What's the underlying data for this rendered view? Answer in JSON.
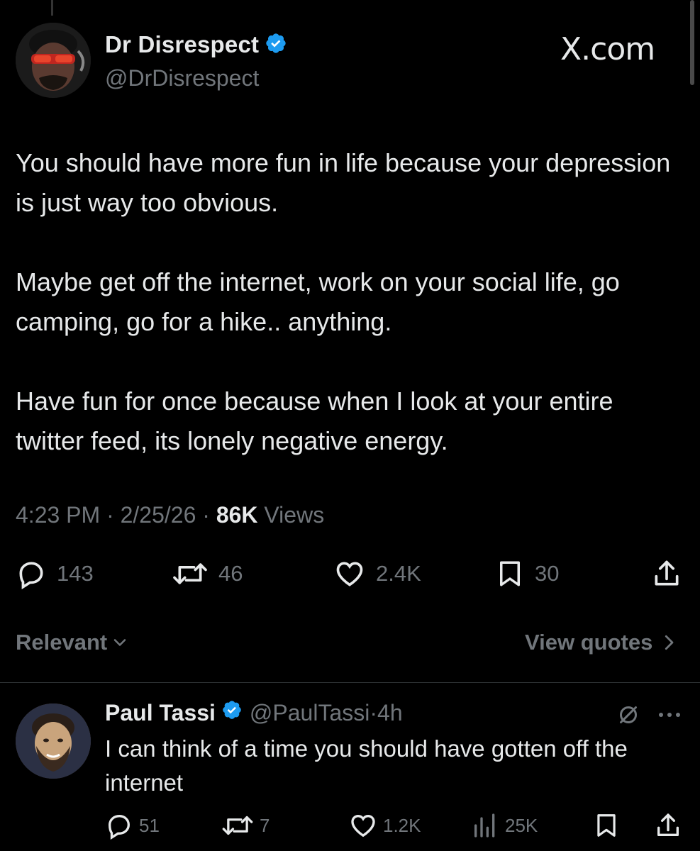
{
  "main_tweet": {
    "author_name": "Dr Disrespect",
    "author_handle": "@DrDisrespect",
    "watermark": "X.com",
    "paragraphs": [
      "You should have more fun in life because your depression is just way too obvious.",
      "Maybe get off the internet, work on your social life, go camping, go for a hike.. anything.",
      "Have fun for once because when I look at your entire twitter feed, its lonely negative energy."
    ],
    "time": "4:23 PM",
    "date": "2/25/26",
    "views_count": "86K",
    "views_label": "Views",
    "stats": {
      "replies": "143",
      "reposts": "46",
      "likes": "2.4K",
      "bookmarks": "30"
    }
  },
  "sort": {
    "relevant_label": "Relevant",
    "view_quotes_label": "View quotes"
  },
  "reply": {
    "author_name": "Paul Tassi",
    "author_handle": "@PaulTassi",
    "age": "4h",
    "text": "I can think of a time you should have gotten off the internet",
    "stats": {
      "replies": "51",
      "reposts": "7",
      "likes": "1.2K",
      "views": "25K"
    }
  },
  "colors": {
    "background": "#000000",
    "text": "#e7e9ea",
    "muted": "#71767b",
    "verified": "#1d9bf0"
  }
}
